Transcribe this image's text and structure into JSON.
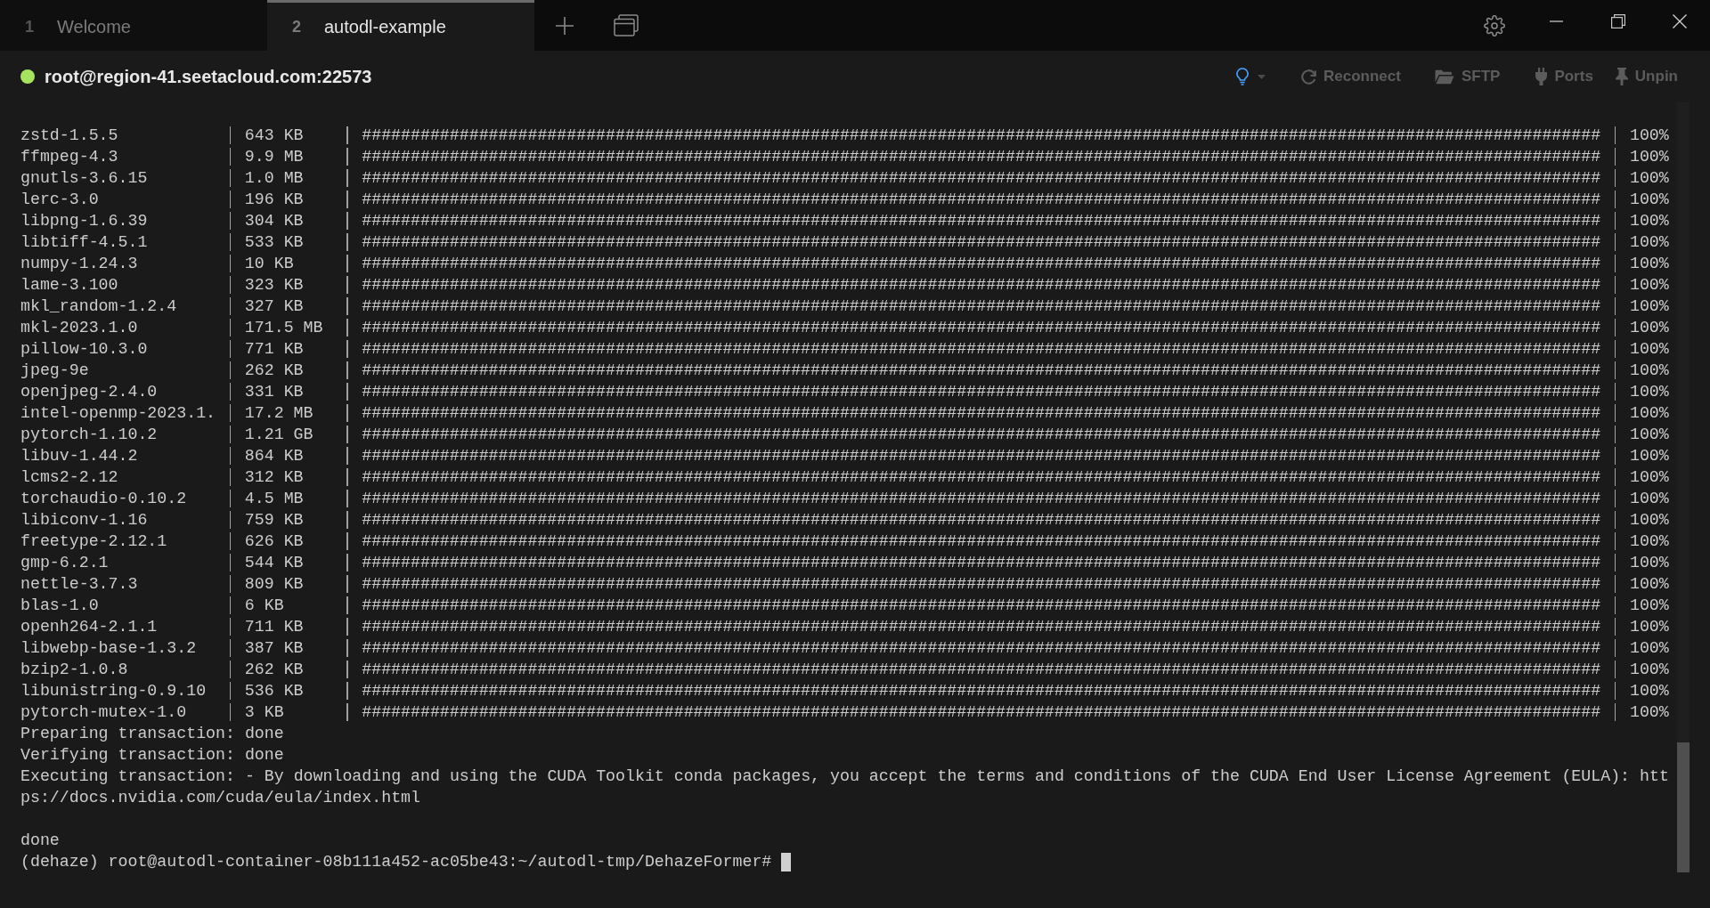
{
  "tabs": [
    {
      "number": "1",
      "label": "Welcome",
      "selected": false
    },
    {
      "number": "2",
      "label": "autodl-example",
      "selected": true
    }
  ],
  "session": {
    "host": "root@region-41.seetacloud.com:22573",
    "connected": true
  },
  "toolbar": [
    {
      "kind": "tips"
    },
    {
      "kind": "reconnect",
      "label": "Reconnect"
    },
    {
      "kind": "sftp",
      "label": "SFTP"
    },
    {
      "kind": "ports",
      "label": "Ports"
    },
    {
      "kind": "unpin",
      "label": "Unpin"
    }
  ],
  "terminal": {
    "progress_rows": [
      {
        "package": "zstd-1.5.5",
        "size": "643 KB",
        "bar": "###############################################################################################################################",
        "percent": "100%"
      },
      {
        "package": "ffmpeg-4.3",
        "size": "9.9 MB",
        "bar": "###############################################################################################################################",
        "percent": "100%"
      },
      {
        "package": "gnutls-3.6.15",
        "size": "1.0 MB",
        "bar": "###############################################################################################################################",
        "percent": "100%"
      },
      {
        "package": "lerc-3.0",
        "size": "196 KB",
        "bar": "###############################################################################################################################",
        "percent": "100%"
      },
      {
        "package": "libpng-1.6.39",
        "size": "304 KB",
        "bar": "###############################################################################################################################",
        "percent": "100%"
      },
      {
        "package": "libtiff-4.5.1",
        "size": "533 KB",
        "bar": "###############################################################################################################################",
        "percent": "100%"
      },
      {
        "package": "numpy-1.24.3",
        "size": "10 KB",
        "bar": "###############################################################################################################################",
        "percent": "100%"
      },
      {
        "package": "lame-3.100",
        "size": "323 KB",
        "bar": "###############################################################################################################################",
        "percent": "100%"
      },
      {
        "package": "mkl_random-1.2.4",
        "size": "327 KB",
        "bar": "###############################################################################################################################",
        "percent": "100%"
      },
      {
        "package": "mkl-2023.1.0",
        "size": "171.5 MB",
        "bar": "###############################################################################################################################",
        "percent": "100%"
      },
      {
        "package": "pillow-10.3.0",
        "size": "771 KB",
        "bar": "###############################################################################################################################",
        "percent": "100%"
      },
      {
        "package": "jpeg-9e",
        "size": "262 KB",
        "bar": "###############################################################################################################################",
        "percent": "100%"
      },
      {
        "package": "openjpeg-2.4.0",
        "size": "331 KB",
        "bar": "###############################################################################################################################",
        "percent": "100%"
      },
      {
        "package": "intel-openmp-2023.1.",
        "size": "17.2 MB",
        "bar": "###############################################################################################################################",
        "percent": "100%"
      },
      {
        "package": "pytorch-1.10.2",
        "size": "1.21 GB",
        "bar": "###############################################################################################################################",
        "percent": "100%"
      },
      {
        "package": "libuv-1.44.2",
        "size": "864 KB",
        "bar": "###############################################################################################################################",
        "percent": "100%"
      },
      {
        "package": "lcms2-2.12",
        "size": "312 KB",
        "bar": "###############################################################################################################################",
        "percent": "100%"
      },
      {
        "package": "torchaudio-0.10.2",
        "size": "4.5 MB",
        "bar": "###############################################################################################################################",
        "percent": "100%"
      },
      {
        "package": "libiconv-1.16",
        "size": "759 KB",
        "bar": "###############################################################################################################################",
        "percent": "100%"
      },
      {
        "package": "freetype-2.12.1",
        "size": "626 KB",
        "bar": "###############################################################################################################################",
        "percent": "100%"
      },
      {
        "package": "gmp-6.2.1",
        "size": "544 KB",
        "bar": "###############################################################################################################################",
        "percent": "100%"
      },
      {
        "package": "nettle-3.7.3",
        "size": "809 KB",
        "bar": "###############################################################################################################################",
        "percent": "100%"
      },
      {
        "package": "blas-1.0",
        "size": "6 KB",
        "bar": "###############################################################################################################################",
        "percent": "100%"
      },
      {
        "package": "openh264-2.1.1",
        "size": "711 KB",
        "bar": "###############################################################################################################################",
        "percent": "100%"
      },
      {
        "package": "libwebp-base-1.3.2",
        "size": "387 KB",
        "bar": "###############################################################################################################################",
        "percent": "100%"
      },
      {
        "package": "bzip2-1.0.8",
        "size": "262 KB",
        "bar": "###############################################################################################################################",
        "percent": "100%"
      },
      {
        "package": "libunistring-0.9.10",
        "size": "536 KB",
        "bar": "###############################################################################################################################",
        "percent": "100%"
      },
      {
        "package": "pytorch-mutex-1.0",
        "size": "3 KB",
        "bar": "###############################################################################################################################",
        "percent": "100%"
      }
    ],
    "output_blocks": [
      [
        "Preparing transaction: done",
        "Verifying transaction: done",
        "Executing transaction: - By downloading and using the CUDA Toolkit conda packages, you accept the terms and conditions of the CUDA End User License Agreement (EULA): htt",
        "ps://docs.nvidia.com/cuda/eula/index.html"
      ],
      [
        "done"
      ]
    ],
    "prompt": {
      "text": "(dehaze) root@autodl-container-08b111a452-ac05be43:~/autodl-tmp/DehazeFormer#",
      "cursor": true
    }
  }
}
